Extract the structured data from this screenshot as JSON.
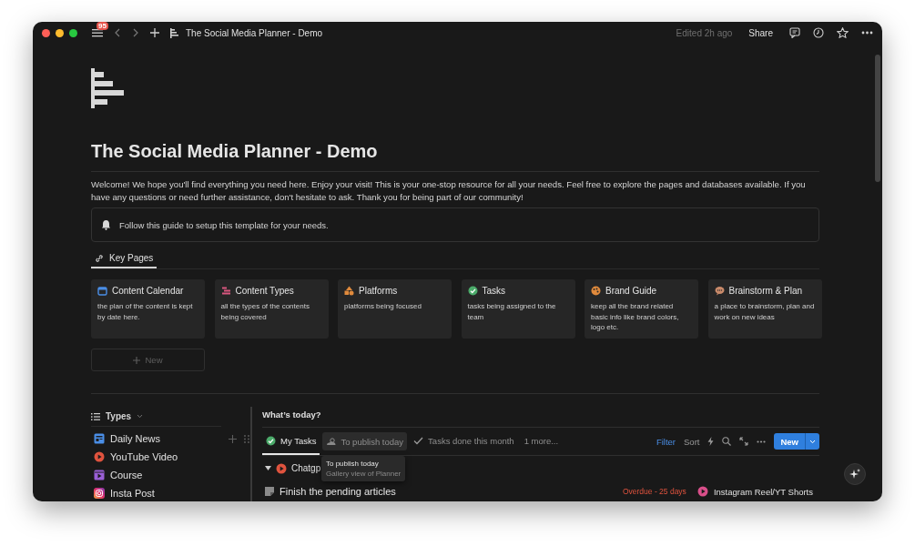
{
  "window": {
    "title": "The Social Media Planner - Demo",
    "badge": "95",
    "edited": "Edited 2h ago",
    "share": "Share"
  },
  "page": {
    "title": "The Social Media Planner - Demo",
    "intro": "Welcome! We hope you'll find everything you need here. Enjoy your visit! This is your one-stop resource for all your needs. Feel free to explore the pages and databases available. If you have any questions or need further assistance, don't hesitate to ask. Thank you for being part of our community!",
    "callout": "Follow this guide to setup this template for your needs.",
    "section_tab": "Key Pages",
    "cards": [
      {
        "title": "Content Calendar",
        "description": "the plan of the content is kept by date here."
      },
      {
        "title": "Content Types",
        "description": "all the types of the contents being covered"
      },
      {
        "title": "Platforms",
        "description": "platforms being focused"
      },
      {
        "title": "Tasks",
        "description": "tasks being assigned to the team"
      },
      {
        "title": "Brand Guide",
        "description": "keep all the brand related basic info like brand colors, logo etc."
      },
      {
        "title": "Brainstorm & Plan",
        "description": "a place to brainstorm, plan and work on new ideas"
      }
    ],
    "new_button": "New"
  },
  "types": {
    "title": "Types",
    "items": [
      {
        "label": "Daily News"
      },
      {
        "label": "YouTube Video"
      },
      {
        "label": "Course"
      },
      {
        "label": "Insta Post"
      }
    ]
  },
  "today": {
    "title": "What’s today?",
    "views": [
      {
        "label": "My Tasks",
        "selected": true,
        "hovered": false
      },
      {
        "label": "To publish today",
        "selected": false,
        "hovered": true
      },
      {
        "label": "Tasks done this month",
        "selected": false,
        "hovered": false
      }
    ],
    "more": "1 more...",
    "toolbar": {
      "filter": "Filter",
      "sort": "Sort",
      "new": "New"
    },
    "tooltip": {
      "title": "To publish today",
      "subtitle": "Gallery view of Planner"
    },
    "group": {
      "label": "Chatgp",
      "expanded": true
    },
    "rows": [
      {
        "title": "Finish the pending articles",
        "due": "Overdue - 25 days",
        "platform": "Instagram Reel/YT Shorts"
      }
    ]
  }
}
